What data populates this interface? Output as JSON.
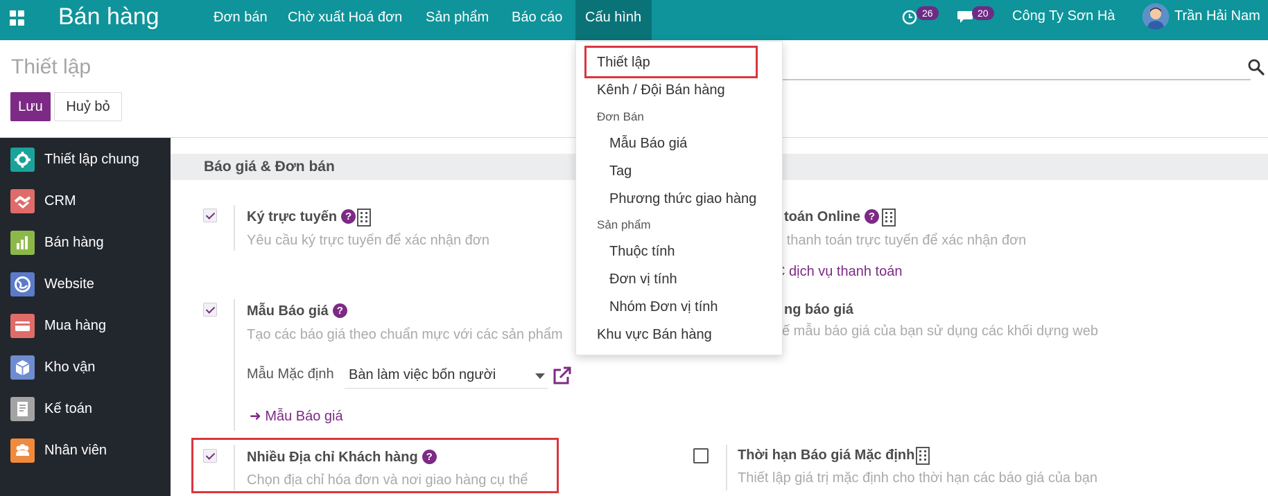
{
  "navbar": {
    "app_name": "Bán hàng",
    "menus": [
      "Đơn bán",
      "Chờ xuất Hoá đơn",
      "Sản phẩm",
      "Báo cáo",
      "Cấu hình"
    ],
    "activity_count": "26",
    "message_count": "20",
    "company": "Công Ty Sơn Hà",
    "user": "Trần Hải Nam"
  },
  "control_panel": {
    "title": "Thiết lập",
    "save_label": "Lưu",
    "discard_label": "Huỷ bỏ"
  },
  "sidebar": {
    "items": [
      {
        "label": "Thiết lập chung",
        "icon": "gear-icon",
        "color": "#1aa39b"
      },
      {
        "label": "CRM",
        "icon": "handshake-icon",
        "color": "#e06c69"
      },
      {
        "label": "Bán hàng",
        "icon": "bar-chart-icon",
        "color": "#8cb84a"
      },
      {
        "label": "Website",
        "icon": "globe-icon",
        "color": "#5b7bc9"
      },
      {
        "label": "Mua hàng",
        "icon": "credit-card-icon",
        "color": "#e06c69"
      },
      {
        "label": "Kho vận",
        "icon": "box-icon",
        "color": "#6e8ccf"
      },
      {
        "label": "Kế toán",
        "icon": "invoice-icon",
        "color": "#a3a3a3"
      },
      {
        "label": "Nhân viên",
        "icon": "people-icon",
        "color": "#f08a3d"
      }
    ]
  },
  "section": {
    "title": "Báo giá & Đơn bán",
    "options": {
      "online_signature": {
        "title": "Ký trực tuyến",
        "desc": "Yêu cầu ký trực tuyến để xác nhận đơn",
        "checked": true
      },
      "online_payment": {
        "title": "toán Online",
        "desc": "u thanh toán trực tuyến để xác nhận đơn",
        "link": "C dịch vụ thanh toán"
      },
      "quotation_templates": {
        "title": "Mẫu Báo giá",
        "desc": "Tạo các báo giá theo chuẩn mực với các sản phẩm",
        "checked": true,
        "default_label": "Mẫu Mặc định",
        "default_value": "Bàn làm việc bốn người",
        "link": "Mẫu Báo giá"
      },
      "quotation_builder": {
        "title": "ng báo giá",
        "desc": "ế mẫu báo giá của bạn sử dụng các khối dựng web"
      },
      "multi_address": {
        "title": "Nhiều Địa chỉ Khách hàng",
        "desc": "Chọn địa chỉ hóa đơn và nơi giao hàng cụ thể",
        "checked": true
      },
      "default_validity": {
        "title": "Thời hạn Báo giá Mặc định",
        "desc": "Thiết lập giá trị mặc định cho thời hạn các báo giá của bạn",
        "checked": false
      }
    }
  },
  "dropdown": {
    "settings": "Thiết lập",
    "sales_teams": "Kênh / Đội Bán hàng",
    "orders_header": "Đơn Bán",
    "quotation_templates": "Mẫu Báo giá",
    "tags": "Tag",
    "delivery_methods": "Phương thức giao hàng",
    "products_header": "Sản phẩm",
    "attributes": "Thuộc tính",
    "uom": "Đơn vị tính",
    "uom_categories": "Nhóm Đơn vị tính",
    "sales_regions": "Khu vực Bán hàng"
  }
}
